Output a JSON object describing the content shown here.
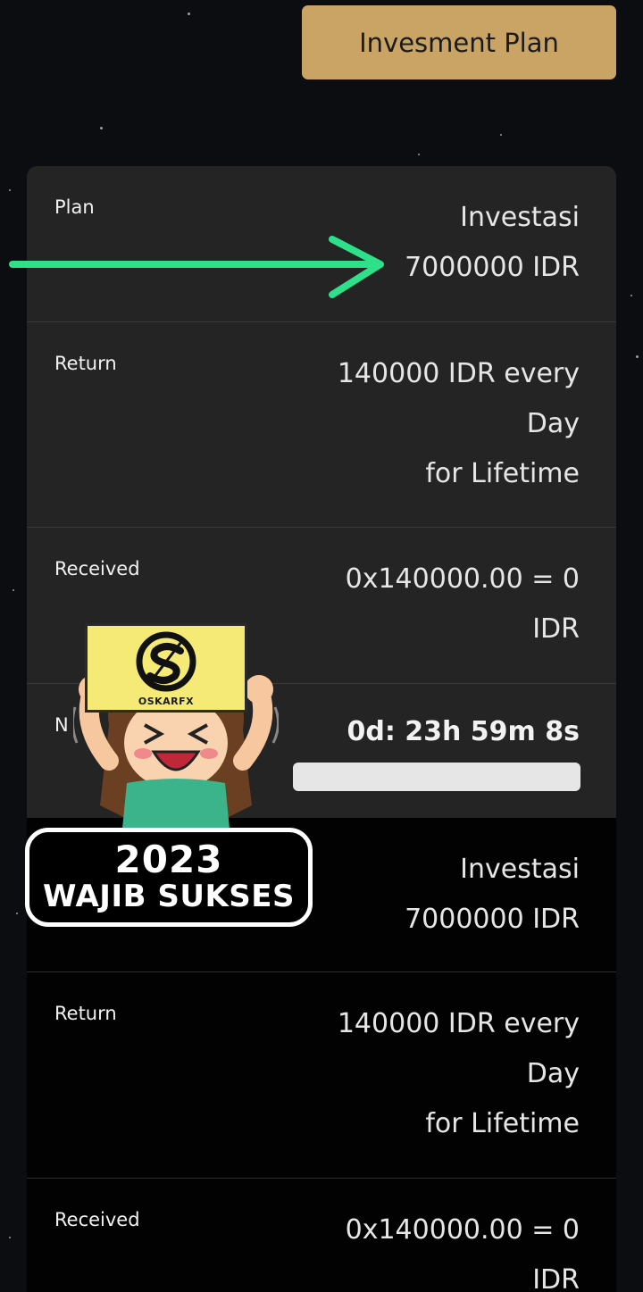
{
  "header": {
    "plan_button_label": "Invesment Plan"
  },
  "card1": {
    "plan_label": "Plan",
    "plan_value_line1": "Investasi",
    "plan_value_line2": "7000000 IDR",
    "return_label": "Return",
    "return_line1": "140000 IDR every",
    "return_line2": "Day",
    "return_line3": "for Lifetime",
    "received_label": "Received",
    "received_line1": "0x140000.00 = 0",
    "received_line2": "IDR",
    "next_label": "N",
    "countdown": "0d: 23h 59m 8s",
    "progress_fraction": 0
  },
  "card2": {
    "plan_value_line1": "Investasi",
    "plan_value_line2": "7000000 IDR",
    "return_label": "Return",
    "return_line1": "140000 IDR every",
    "return_line2": "Day",
    "return_line3": "for Lifetime",
    "received_label": "Received",
    "received_line1": "0x140000.00 = 0",
    "received_line2": "IDR"
  },
  "overlay": {
    "sign_text": "OSKARFX",
    "badge_year": "2023",
    "badge_text": "WAJIB SUKSES"
  },
  "colors": {
    "background": "#0c0d10",
    "gold_button": "#c9a464",
    "card_gray": "#242424",
    "card_black": "#020202",
    "arrow_green": "#2ee08a"
  }
}
